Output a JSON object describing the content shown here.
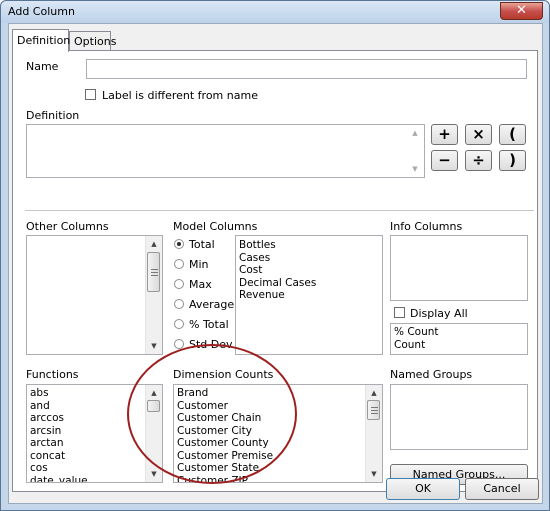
{
  "window": {
    "title": "Add Column",
    "close_glyph": "✕"
  },
  "tabs": [
    {
      "label": "Definition"
    },
    {
      "label": "Options"
    }
  ],
  "name_field": {
    "label": "Name",
    "value": ""
  },
  "label_diff": {
    "label": "Label is different from name",
    "checked": false
  },
  "definition": {
    "label": "Definition",
    "value": ""
  },
  "operators": [
    "+",
    "×",
    "(",
    "−",
    "÷",
    ")"
  ],
  "other_columns": {
    "label": "Other Columns",
    "items": []
  },
  "model_columns": {
    "label": "Model Columns",
    "aggregations": [
      {
        "label": "Total",
        "selected": true
      },
      {
        "label": "Min",
        "selected": false
      },
      {
        "label": "Max",
        "selected": false
      },
      {
        "label": "Average",
        "selected": false
      },
      {
        "label": "% Total",
        "selected": false
      },
      {
        "label": "Std Dev",
        "selected": false
      }
    ],
    "items": [
      "Bottles",
      "Cases",
      "Cost",
      "Decimal Cases",
      "Revenue"
    ]
  },
  "info_columns": {
    "label": "Info Columns",
    "display_all": {
      "label": "Display All",
      "checked": false
    },
    "items": [
      "% Count",
      "Count"
    ]
  },
  "functions": {
    "label": "Functions",
    "items": [
      "abs",
      "and",
      "arccos",
      "arcsin",
      "arctan",
      "concat",
      "cos",
      "date_value"
    ]
  },
  "dimension_counts": {
    "label": "Dimension Counts",
    "items": [
      "Brand",
      "Customer",
      "Customer Chain",
      "Customer City",
      "Customer County",
      "Customer Premise",
      "Customer State",
      "Customer ZIP"
    ]
  },
  "named_groups": {
    "label": "Named Groups",
    "button": "Named Groups..."
  },
  "footer": {
    "ok": "OK",
    "cancel": "Cancel"
  }
}
